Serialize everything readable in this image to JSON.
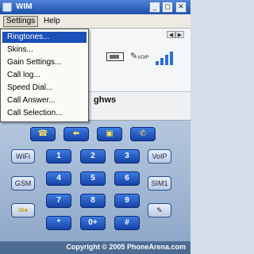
{
  "window": {
    "title": "WIM"
  },
  "menubar": {
    "items": [
      "Settings",
      "Help"
    ]
  },
  "dropdown": {
    "items": [
      {
        "label": "Ringtones...",
        "selected": true
      },
      {
        "label": "Skins..."
      },
      {
        "label": "Gain Settings..."
      },
      {
        "label": "Call log..."
      },
      {
        "label": "Speed Dial..."
      },
      {
        "label": "Call Answer..."
      },
      {
        "label": "Call Selection..."
      }
    ]
  },
  "status": {
    "voip_label": "VOIP",
    "display_name_partial": "ghws"
  },
  "keypad": {
    "top_icons": [
      "phone-icon",
      "back-arrow-icon",
      "contacts-icon",
      "hangup-icon"
    ],
    "digits": [
      "1",
      "2",
      "3",
      "4",
      "5",
      "6",
      "7",
      "8",
      "9",
      "*",
      "0+",
      "#"
    ],
    "side_left": [
      "WiFi",
      "GSM",
      "menu-icon"
    ],
    "side_right": [
      "VoIP",
      "SIM1",
      "pen-icon"
    ]
  },
  "footer": {
    "copyright": "Copyright © 2005 PhoneArena.com"
  },
  "colors": {
    "accent": "#1a50b8",
    "key_blue": "#2a5fcf",
    "selection": "#1a50b8"
  }
}
